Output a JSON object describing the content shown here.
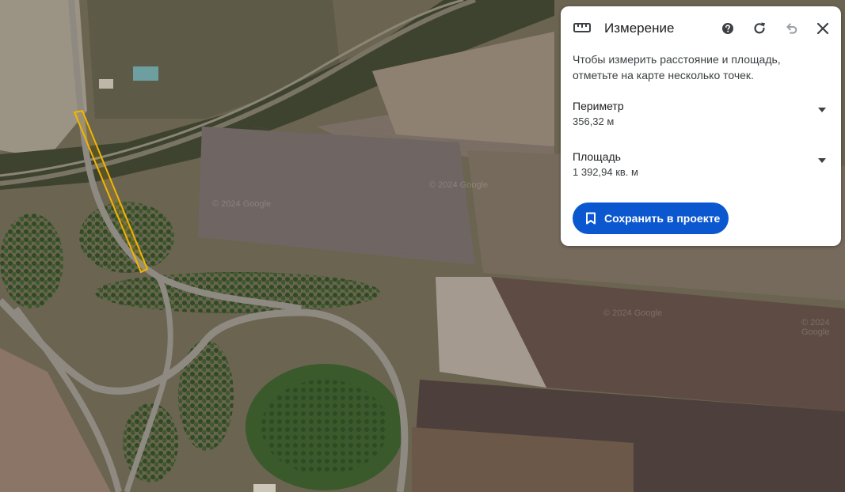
{
  "panel": {
    "title": "Измерение",
    "description": "Чтобы измерить расстояние и площадь, отметьте на карте несколько точек.",
    "perimeter": {
      "label": "Периметр",
      "value": "356,32 м"
    },
    "area": {
      "label": "Площадь",
      "value": "1 392,94 кв. м"
    },
    "save_label": "Сохранить в проекте",
    "icons": [
      "ruler-icon",
      "help-icon",
      "refresh-icon",
      "undo-icon",
      "close-icon",
      "bookmark-icon"
    ]
  },
  "map": {
    "watermarks": [
      "© 2024 Google",
      "© 2024 Google",
      "© 2024 Google",
      "© 2024 Google"
    ]
  },
  "colors": {
    "accent": "#0b57d0",
    "measure_outline": "#f4b400",
    "panel_bg": "#ffffff"
  }
}
